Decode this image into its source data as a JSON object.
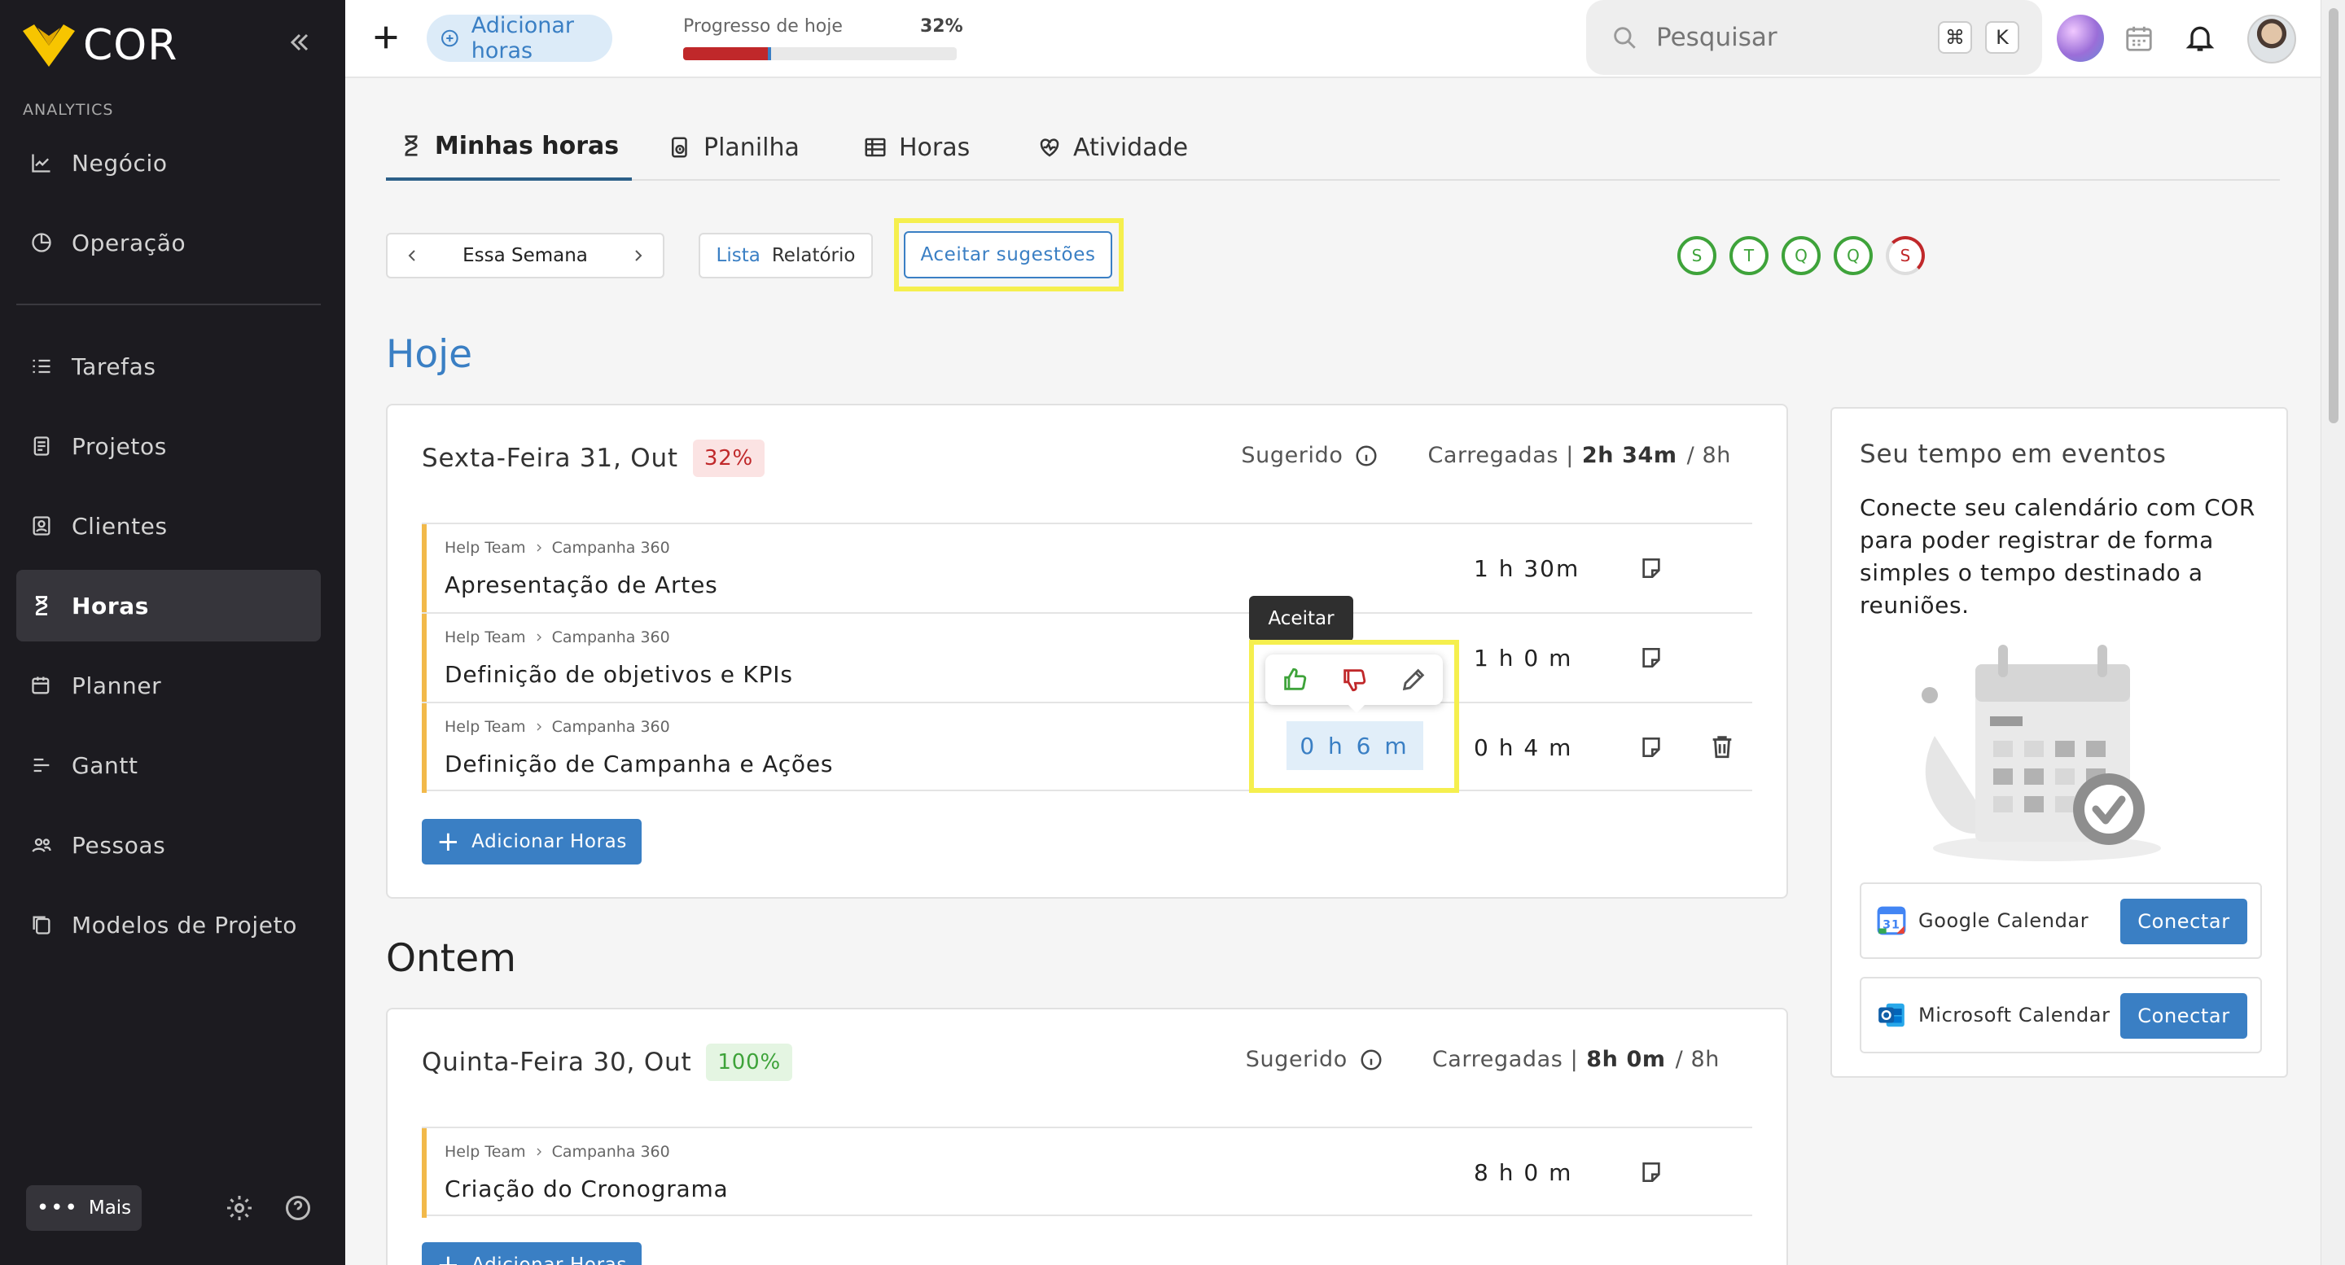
{
  "brand": {
    "name": "COR"
  },
  "sidebar": {
    "section_label": "ANALYTICS",
    "items": [
      {
        "label": "Negócio",
        "icon": "chart-line-icon"
      },
      {
        "label": "Operação",
        "icon": "pie-chart-icon"
      },
      {
        "label": "Tarefas",
        "icon": "checklist-icon"
      },
      {
        "label": "Projetos",
        "icon": "document-icon"
      },
      {
        "label": "Clientes",
        "icon": "contact-card-icon"
      },
      {
        "label": "Horas",
        "icon": "hourglass-icon",
        "active": true
      },
      {
        "label": "Planner",
        "icon": "calendar-edit-icon"
      },
      {
        "label": "Gantt",
        "icon": "gantt-icon"
      },
      {
        "label": "Pessoas",
        "icon": "people-icon"
      },
      {
        "label": "Modelos de Projeto",
        "icon": "copy-document-icon"
      }
    ],
    "more_label": "Mais"
  },
  "topbar": {
    "add_hours_label": "Adicionar horas",
    "progress_label": "Progresso de hoje",
    "progress_value": "32%",
    "progress_fraction": 0.32,
    "search_placeholder": "Pesquisar",
    "shortcut_key1": "⌘",
    "shortcut_key2": "K"
  },
  "tabs": [
    {
      "label": "Minhas horas",
      "icon": "hourglass-icon",
      "active": true
    },
    {
      "label": "Planilha",
      "icon": "clock-sheet-icon"
    },
    {
      "label": "Horas",
      "icon": "table-icon"
    },
    {
      "label": "Atividade",
      "icon": "heart-pulse-icon"
    }
  ],
  "filters": {
    "week_label": "Essa Semana",
    "view_list": "Lista",
    "view_report": "Relatório",
    "accept_suggestions": "Aceitar sugestões",
    "day_circles": [
      "S",
      "T",
      "Q",
      "Q",
      "S"
    ]
  },
  "today": {
    "section_title": "Hoje",
    "day_title": "Sexta-Feira 31, Out",
    "percent": "32%",
    "suggested_label": "Sugerido",
    "loaded_label": "Carregadas |",
    "loaded_value": "2h 34m",
    "goal": "/  8h",
    "tasks": [
      {
        "team": "Help Team",
        "project": "Campanha 360",
        "name": "Apresentação de Artes",
        "hours": "1 h  30m"
      },
      {
        "team": "Help Team",
        "project": "Campanha 360",
        "name": "Definição de objetivos e KPIs",
        "hours": "1 h  0 m"
      },
      {
        "team": "Help Team",
        "project": "Campanha 360",
        "name": "Definição de Campanha e Ações",
        "hours": "0 h  4 m",
        "suggested": "0 h  6 m"
      }
    ],
    "add_button": "Adicionar Horas",
    "tooltip": "Aceitar"
  },
  "yesterday": {
    "section_title": "Ontem",
    "day_title": "Quinta-Feira 30, Out",
    "percent": "100%",
    "suggested_label": "Sugerido",
    "loaded_label": "Carregadas |",
    "loaded_value": "8h 0m",
    "goal": "/  8h",
    "tasks": [
      {
        "team": "Help Team",
        "project": "Campanha 360",
        "name": "Criação do Cronograma",
        "hours": "8 h  0 m"
      }
    ],
    "add_button": "Adicionar Horas"
  },
  "events_panel": {
    "title": "Seu tempo em eventos",
    "description": "Conecte seu calendário com COR para poder registrar de forma simples o tempo destinado a reuniões.",
    "connectors": [
      {
        "name": "Google Calendar",
        "button": "Conectar"
      },
      {
        "name": "Microsoft Calendar",
        "button": "Conectar"
      }
    ]
  },
  "colors": {
    "accent": "#3a7fc4",
    "sidebar_bg": "#1c1b20",
    "highlight": "#f5ef4e",
    "success": "#3ea33a",
    "danger": "#c0282a",
    "task_bar": "#f2b94a"
  }
}
